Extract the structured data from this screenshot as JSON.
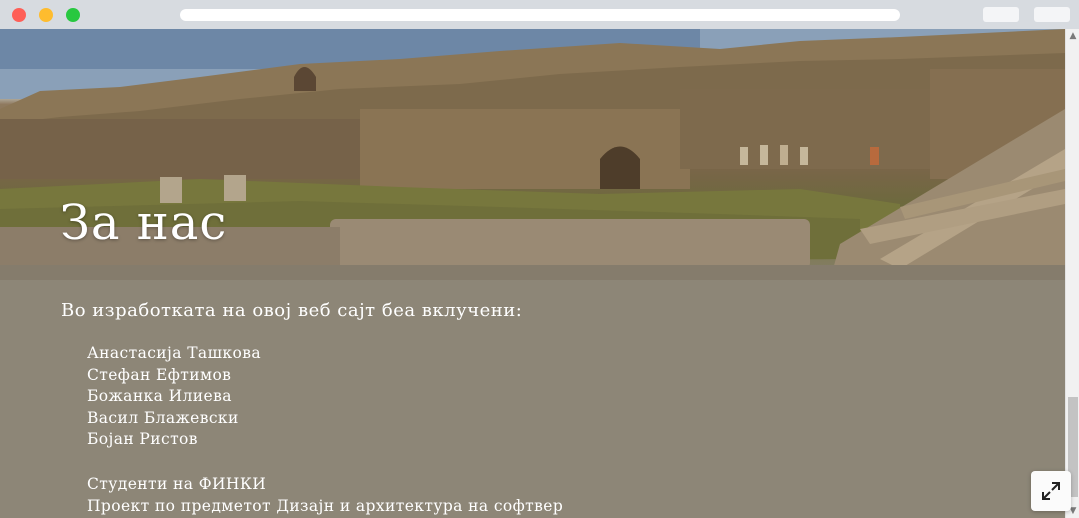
{
  "hero": {
    "title": "За нас"
  },
  "content": {
    "intro": "Во изработката на овој веб сајт беа вклучени:",
    "people": [
      "Анастасија Ташкова",
      "Стефан Ефтимов",
      "Божанка Илиева",
      "Васил Блажевски",
      "Бојан Ристов"
    ],
    "footer": [
      "Студенти на ФИНКИ",
      "Проект по предметот Дизајн и архитектура на софтвер"
    ]
  },
  "scrollbar": {
    "up_glyph": "▲",
    "down_glyph": "▼"
  },
  "icons": {
    "expand": "expand-icon"
  },
  "colors": {
    "content_background": "#8d8677",
    "text": "#ffffff"
  }
}
